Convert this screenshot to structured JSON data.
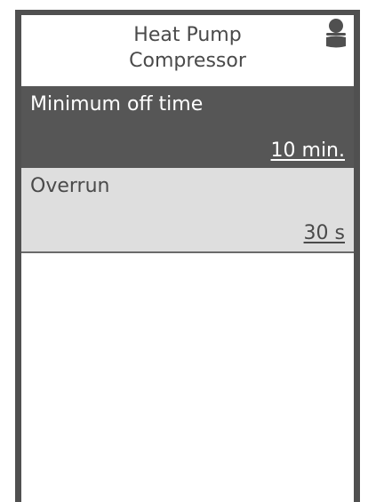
{
  "header": {
    "title_line1": "Heat Pump",
    "title_line2": "Compressor",
    "user_icon": "user-icon"
  },
  "parameters": [
    {
      "label": "Minimum off time",
      "value": "10 min.",
      "selected": true
    },
    {
      "label": "Overrun",
      "value": "30 s",
      "selected": false
    }
  ],
  "colors": {
    "frame": "#505050",
    "selected_row_bg": "#565656",
    "row_bg": "#dedede",
    "text": "#4a4a4a"
  }
}
